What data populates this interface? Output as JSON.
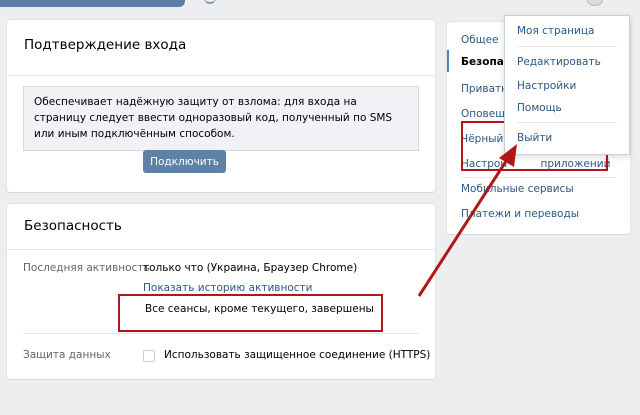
{
  "header": {
    "search_icon": "search-bar",
    "notification_icon": "bell-icon",
    "avatar_icon": "user-avatar"
  },
  "login_confirm": {
    "title": "Подтверждение входа",
    "description": "Обеспечивает надёжную защиту от взлома: для входа на страницу следует ввести одноразовый код, полученный по SMS или иным подключённым способом.",
    "connect_button": "Подключить"
  },
  "security": {
    "title": "Безопасность",
    "last_activity_label": "Последняя активность",
    "last_activity_value": "только что (Украина, Браузер Chrome)",
    "show_history_link": "Показать историю активности",
    "sessions_ended": "Все сеансы, кроме текущего, завершены",
    "data_protection_label": "Защита данных",
    "https_checkbox_label": "Использовать защищенное соединение (HTTPS)",
    "https_checked": false
  },
  "settings_menu": {
    "items": [
      "Общее",
      "Безопасность",
      "Приватность",
      "Оповещения",
      "Чёрный список",
      "Настройки приложений",
      "Мобильные сервисы",
      "Платежи и переводы"
    ],
    "visible_labels": [
      "Общее",
      "Безопас",
      "Приватн",
      "Оповещ",
      "Чёрный с",
      "Настрой",
      "приложений",
      "Мобильные сервисы",
      "Платежи и переводы"
    ],
    "active_index": 1
  },
  "profile_dropdown": {
    "items": [
      "Моя страница",
      "Редактировать",
      "Настройки",
      "Помощь",
      "Выйти"
    ]
  },
  "annotation_color": "#b01818"
}
